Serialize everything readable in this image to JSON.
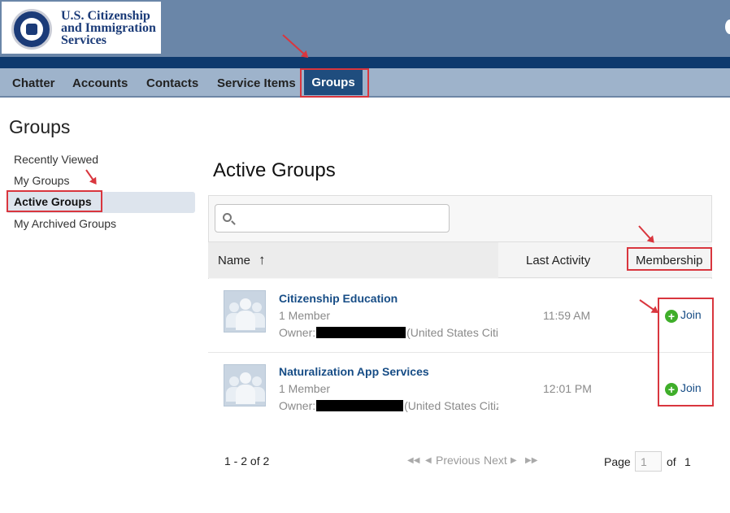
{
  "brand": {
    "line1": "U.S. Citizenship",
    "line2": "and Immigration",
    "line3": "Services",
    "colors": {
      "header": "#6a86a8",
      "header_dark": "#0e3a6e",
      "nav": "#9eb3cb",
      "nav_active": "#1f4d7e",
      "annotation": "#d9363e",
      "link": "#174d86"
    }
  },
  "nav": {
    "items": [
      "Chatter",
      "Accounts",
      "Contacts",
      "Service Items"
    ],
    "active": "Groups"
  },
  "sidebar": {
    "title": "Groups",
    "items": [
      {
        "label": "Recently Viewed"
      },
      {
        "label": "My Groups"
      },
      {
        "label": "Active Groups",
        "selected": true
      },
      {
        "label": "My Archived Groups"
      }
    ]
  },
  "main": {
    "title": "Active Groups",
    "search": {
      "placeholder": "",
      "value": "",
      "icon": "search-icon"
    },
    "columns": {
      "name": "Name",
      "sort_icon": "↑",
      "last_activity": "Last Activity",
      "membership": "Membership"
    },
    "rows": [
      {
        "name": "Citizenship Education",
        "members": "1 Member",
        "owner_label": "Owner:",
        "owner_suffix": "(United States Citiz",
        "last_activity": "11:59 AM",
        "action": "Join",
        "action_icon": "plus-circle-icon"
      },
      {
        "name": "Naturalization App Services",
        "members": "1 Member",
        "owner_label": "Owner:",
        "owner_suffix": "(United States Citiz",
        "last_activity": "12:01 PM",
        "action": "Join",
        "action_icon": "plus-circle-icon"
      }
    ]
  },
  "pagination": {
    "range": "1 - 2 of 2",
    "previous": "Previous",
    "next": "Next",
    "page_label": "Page",
    "page_value": "1",
    "of_label": "of",
    "total_pages": "1"
  }
}
